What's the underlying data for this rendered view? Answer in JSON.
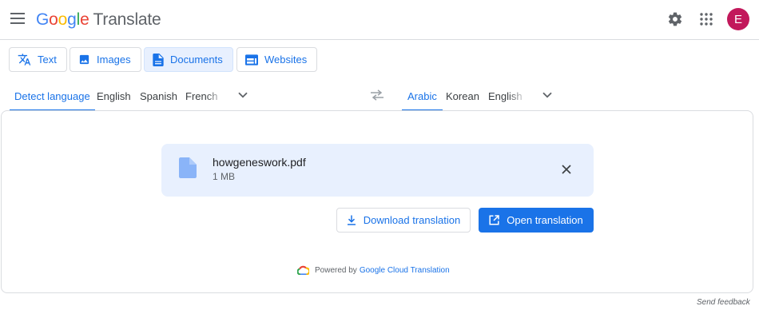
{
  "header": {
    "brand": {
      "g1": "G",
      "o1": "o",
      "o2": "o",
      "g2": "g",
      "l": "l",
      "e": "e",
      "product": "Translate"
    },
    "avatar_initial": "E",
    "icons": [
      "menu-icon",
      "settings-icon",
      "apps-icon"
    ]
  },
  "modes": [
    {
      "label": "Text",
      "icon": "translate-icon",
      "active": false
    },
    {
      "label": "Images",
      "icon": "image-icon",
      "active": false
    },
    {
      "label": "Documents",
      "icon": "document-icon",
      "active": true
    },
    {
      "label": "Websites",
      "icon": "website-icon",
      "active": false
    }
  ],
  "source_languages": {
    "detect": "Detect language",
    "items": [
      "English",
      "Spanish",
      "French"
    ],
    "selected": "Detect language"
  },
  "target_languages": {
    "items": [
      "Arabic",
      "Korean",
      "English"
    ],
    "selected": "Arabic"
  },
  "file": {
    "name": "howgeneswork.pdf",
    "size": "1 MB"
  },
  "actions": {
    "download": "Download translation",
    "open": "Open translation"
  },
  "powered": {
    "prefix": "Powered by",
    "link": "Google Cloud Translation"
  },
  "feedback": "Send feedback",
  "colors": {
    "accent": "#1a73e8",
    "card_bg": "#e8f0fe",
    "avatar_bg": "#c2185b",
    "border": "#dadce0"
  }
}
